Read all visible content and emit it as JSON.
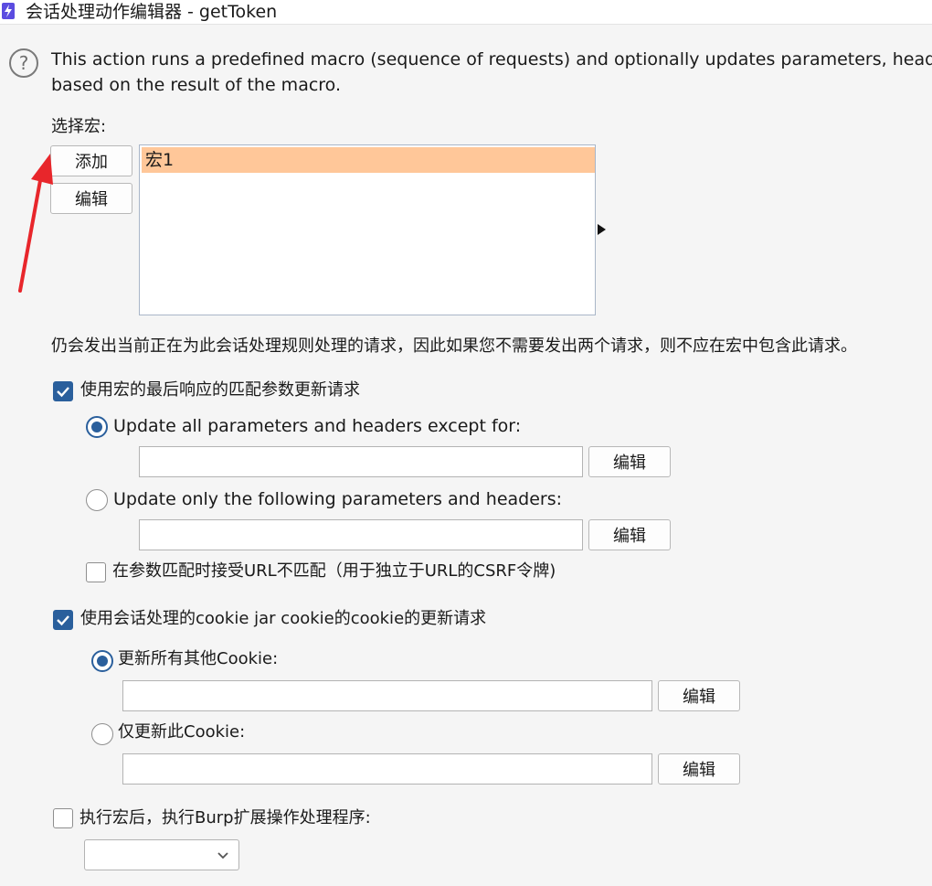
{
  "window": {
    "title": "会话处理动作编辑器 - getToken",
    "app_icon": "lightning-bolt-icon",
    "accent_color": "#5b4ce0"
  },
  "help_icon": "question-circle-icon",
  "description": {
    "line1": "This action runs a predefined macro (sequence of requests) and optionally updates parameters, heade",
    "line2": "based on the result of the macro."
  },
  "macro": {
    "label": "选择宏:",
    "add_button": "添加",
    "edit_button": "编辑",
    "items": [
      {
        "label": "宏1",
        "selected": true
      }
    ],
    "selection_color": "#ffc799"
  },
  "note": "仍会发出当前正在为此会话处理规则处理的请求，因此如果您不需要发出两个请求，则不应在宏中包含此请求。",
  "params_update": {
    "label": "使用宏的最后响应的匹配参数更新请求",
    "checked": true,
    "option_all": {
      "label": "Update all parameters and headers except for:",
      "selected": true,
      "value": "",
      "edit_button": "编辑"
    },
    "option_only": {
      "label": "Update only the following parameters and headers:",
      "selected": false,
      "value": "",
      "edit_button": "编辑"
    },
    "url_mismatch": {
      "label": "在参数匹配时接受URL不匹配（用于独立于URL的CSRF令牌)",
      "checked": false
    }
  },
  "cookie_update": {
    "label": "使用会话处理的cookie jar cookie的cookie的更新请求",
    "checked": true,
    "option_all": {
      "label": "更新所有其他Cookie:",
      "selected": true,
      "value": "",
      "edit_button": "编辑"
    },
    "option_only": {
      "label": "仅更新此Cookie:",
      "selected": false,
      "value": "",
      "edit_button": "编辑"
    }
  },
  "extension": {
    "label": "执行宏后，执行Burp扩展操作处理程序:",
    "checked": false,
    "selected_handler": ""
  },
  "annotation": {
    "type": "red-arrow",
    "color": "#e8262b",
    "points_to": "添加"
  },
  "checkbox_color": "#2a5f9c"
}
